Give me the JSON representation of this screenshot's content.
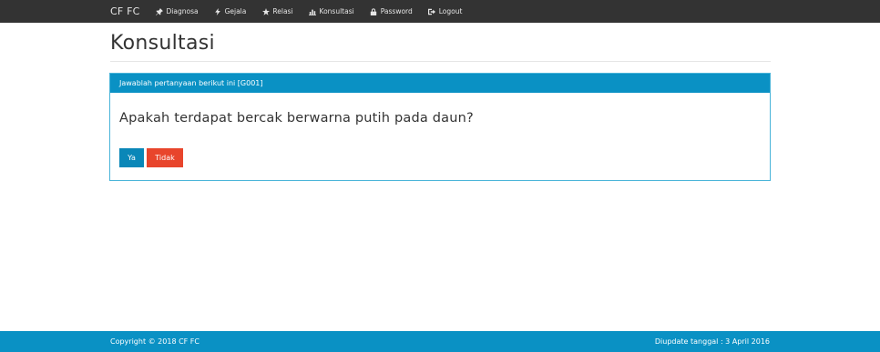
{
  "navbar": {
    "brand": "CF FC",
    "items": [
      {
        "label": "Diagnosa",
        "icon": "pushpin-icon"
      },
      {
        "label": "Gejala",
        "icon": "flash-icon"
      },
      {
        "label": "Relasi",
        "icon": "star-icon"
      },
      {
        "label": "Konsultasi",
        "icon": "stats-icon"
      },
      {
        "label": "Password",
        "icon": "lock-icon"
      },
      {
        "label": "Logout",
        "icon": "logout-icon"
      }
    ]
  },
  "main": {
    "title": "Konsultasi",
    "panel": {
      "heading": "Jawablah pertanyaan berikut ini [G001]",
      "question": "Apakah terdapat bercak berwarna putih pada daun?",
      "yes_label": "Ya",
      "no_label": "Tidak"
    }
  },
  "footer": {
    "copyright": "Copyright © 2018 CF FC",
    "updated": "Diupdate tanggal : 3 April 2016"
  },
  "colors": {
    "navbar": "#333333",
    "primary": "#0a91c4",
    "danger": "#e8452c"
  }
}
